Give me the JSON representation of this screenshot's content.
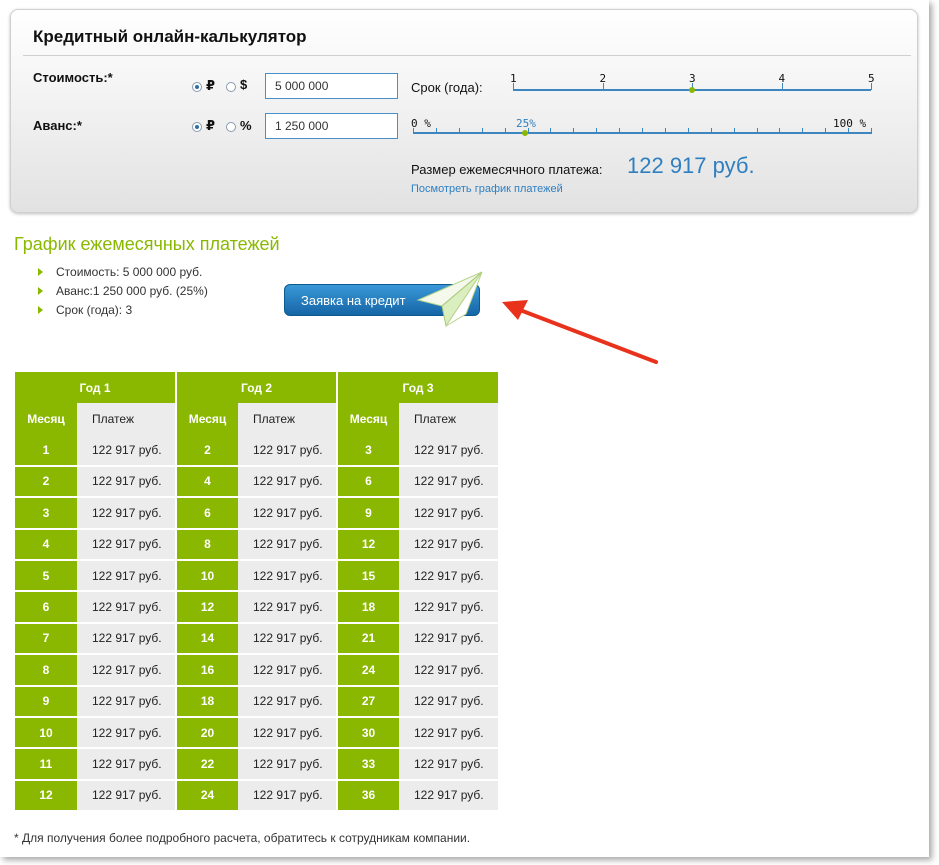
{
  "calculator": {
    "title": "Кредитный онлайн-калькулятор",
    "cost": {
      "label": "Стоимость:*",
      "currency_options": [
        "₽",
        "$"
      ],
      "selected": "₽",
      "value": "5 000 000"
    },
    "advance": {
      "label": "Аванс:*",
      "options": [
        "₽",
        "%"
      ],
      "selected": "₽",
      "value": "1 250 000"
    },
    "term": {
      "label": "Срок (года):",
      "ticks": [
        "1",
        "2",
        "3",
        "4",
        "5"
      ],
      "value": 3
    },
    "advance_slider": {
      "min_label": "0 %",
      "max_label": "100 %",
      "value_label": "25%",
      "value": 25
    },
    "payment": {
      "label": "Размер ежемесячного платежа:",
      "value": "122 917 руб.",
      "link": "Посмотреть график платежей"
    }
  },
  "schedule": {
    "title": "График ежемесячных платежей",
    "summary": [
      "Стоимость: 5 000 000 руб.",
      "Аванс:1 250 000 руб. (25%)",
      "Срок (года): 3"
    ],
    "apply_button": "Заявка на кредит",
    "table": {
      "years": [
        "Год 1",
        "Год 2",
        "Год 3"
      ],
      "month_header": "Месяц",
      "payment_header": "Платеж",
      "payment_value": "122 917 руб.",
      "rows": [
        [
          "1",
          "2",
          "3"
        ],
        [
          "2",
          "4",
          "6"
        ],
        [
          "3",
          "6",
          "9"
        ],
        [
          "4",
          "8",
          "12"
        ],
        [
          "5",
          "10",
          "15"
        ],
        [
          "6",
          "12",
          "18"
        ],
        [
          "7",
          "14",
          "21"
        ],
        [
          "8",
          "16",
          "24"
        ],
        [
          "9",
          "18",
          "27"
        ],
        [
          "10",
          "20",
          "30"
        ],
        [
          "11",
          "22",
          "33"
        ],
        [
          "12",
          "24",
          "36"
        ]
      ]
    },
    "footnote": "* Для получения более подробного расчета, обратитесь к сотрудникам компании."
  },
  "colors": {
    "accent_green": "#8ab800",
    "accent_blue": "#2e7fc1",
    "arrow_red": "#e8321c"
  }
}
